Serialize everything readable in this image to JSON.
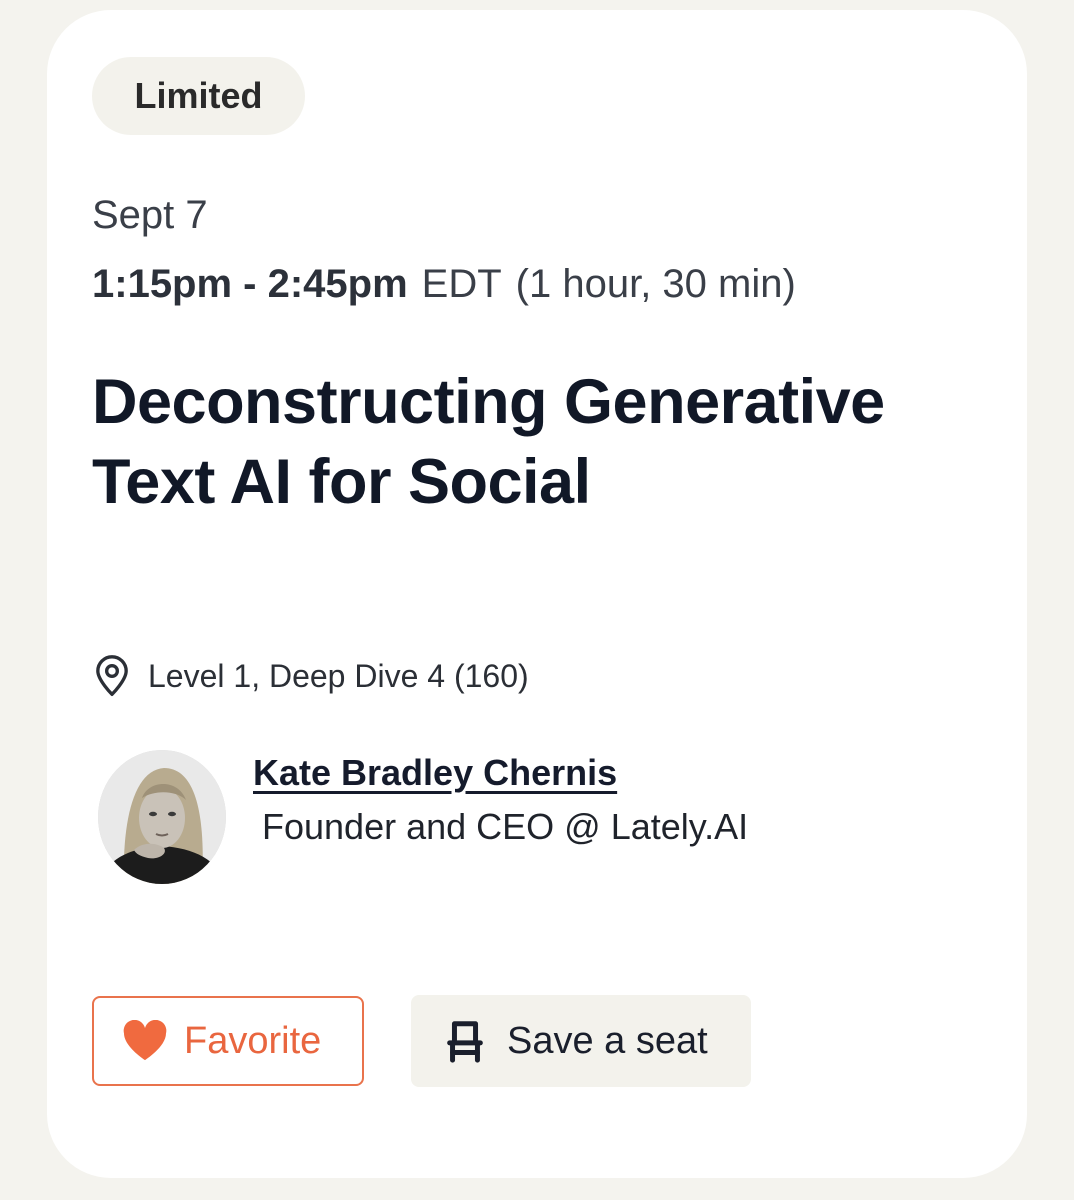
{
  "badge": "Limited",
  "session": {
    "date": "Sept 7",
    "time_range": "1:15pm - 2:45pm",
    "timezone": "EDT",
    "duration": "(1 hour, 30 min)",
    "title": "Deconstructing Generative Text AI for Social",
    "location": "Level 1, Deep Dive 4 (160)"
  },
  "speaker": {
    "name": "Kate Bradley Chernis",
    "role": "Founder and CEO @ Lately.AI"
  },
  "actions": {
    "favorite_label": "Favorite",
    "save_seat_label": "Save a seat"
  },
  "icons": {
    "location": "map-pin-icon",
    "favorite": "heart-icon",
    "seat": "chair-icon"
  },
  "colors": {
    "accent": "#e9663f",
    "page_background": "#f4f3ee",
    "card_background": "#ffffff",
    "chip_background": "#f3f2ec",
    "title_text": "#111827"
  }
}
